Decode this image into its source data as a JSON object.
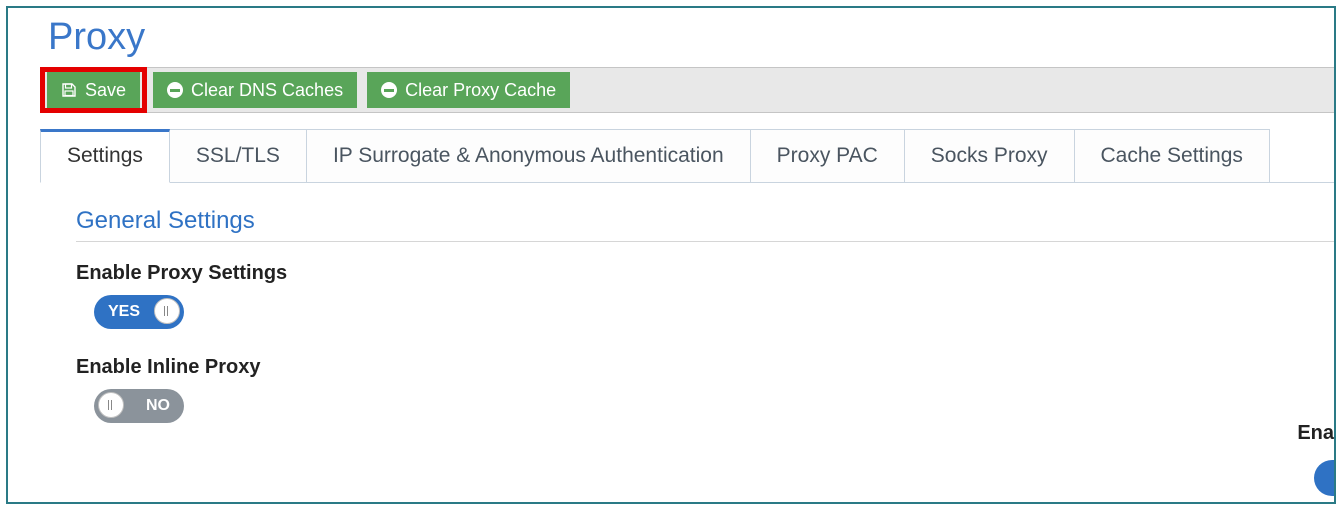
{
  "page": {
    "title": "Proxy"
  },
  "toolbar": {
    "save_label": "Save",
    "clear_dns_label": "Clear DNS Caches",
    "clear_proxy_label": "Clear Proxy Cache"
  },
  "tabs": [
    {
      "label": "Settings",
      "active": true
    },
    {
      "label": "SSL/TLS",
      "active": false
    },
    {
      "label": "IP Surrogate & Anonymous Authentication",
      "active": false
    },
    {
      "label": "Proxy PAC",
      "active": false
    },
    {
      "label": "Socks Proxy",
      "active": false
    },
    {
      "label": "Cache Settings",
      "active": false
    }
  ],
  "section": {
    "title": "General Settings"
  },
  "settings": {
    "enable_proxy": {
      "label": "Enable Proxy Settings",
      "value": "YES",
      "state": "on"
    },
    "enable_inline": {
      "label": "Enable Inline Proxy",
      "value": "NO",
      "state": "off"
    },
    "partial_right": {
      "label": "Ena"
    }
  },
  "colors": {
    "accent": "#2f72c4",
    "btn_green": "#59a559",
    "highlight": "#e40000"
  }
}
